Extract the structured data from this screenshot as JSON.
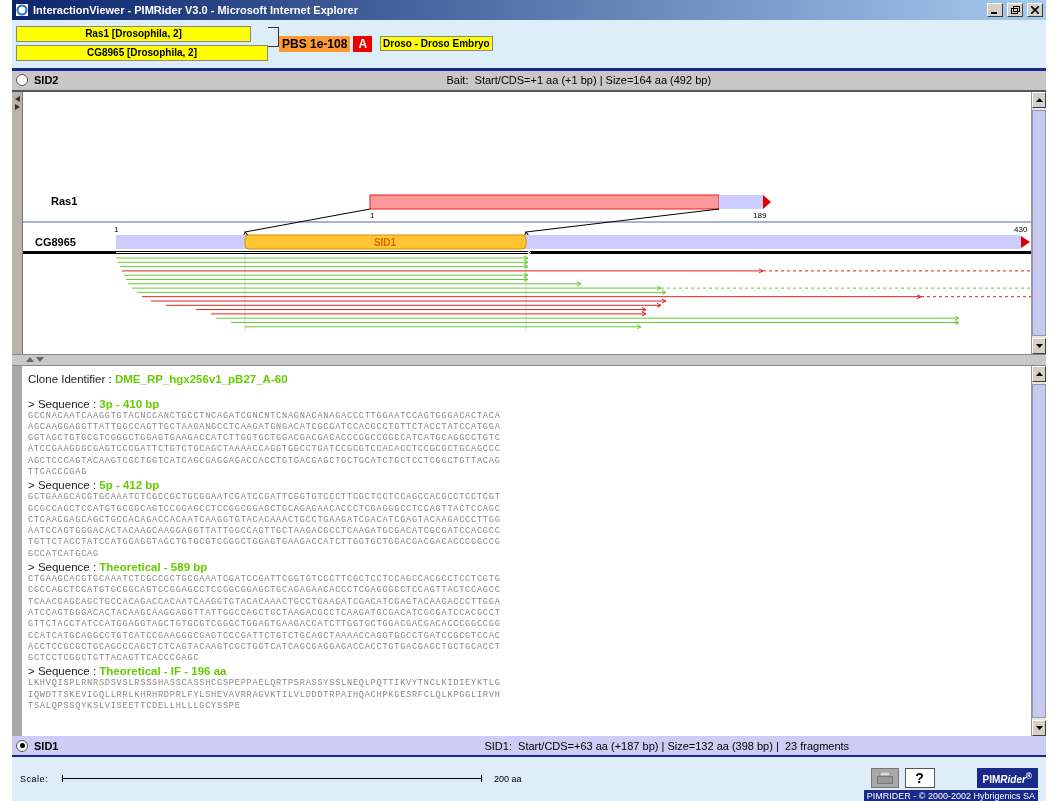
{
  "window": {
    "title": "InteractionViewer - PIMRider V3.0 - Microsoft Internet Explorer"
  },
  "header": {
    "proteins": [
      "Ras1 [Drosophila, 2]",
      "CG8965 [Drosophila, 2]"
    ],
    "score": "PBS 1e-108",
    "grade": "A",
    "library": "Droso - Droso Embryo"
  },
  "bait_bar": {
    "label": "SID2",
    "selected": false,
    "info": "Bait:  Start/CDS=+1 aa (+1 bp) | Size=164 aa (492 bp)"
  },
  "diagram": {
    "bait_name": "Ras1",
    "bait_start": "1",
    "bait_end": "189",
    "prey_name": "CG8965",
    "prey_start": "1",
    "prey_end": "430",
    "domain": "SID1"
  },
  "details": {
    "clone_label": "Clone Identifier : ",
    "clone_id": "DME_RP_hgx256v1_pB27_A-60",
    "sequences": [
      {
        "label": "> Sequence : ",
        "title": "3p - 410 bp",
        "lines": [
          "GCCNACAATCAAGGTGTACNCCANCTGCCTNCAGATCGNCNTCNAGNACANAGACCCTTGGAATCCAGTGGGACACTACA",
          "AGCAAGGAGGTTATTGGCCAGTTGCTAAGANGCCTCAAGATGNGACATCGCGATCCACGCCTGTTCTACCTATCCATGGA",
          "GGTAGCTGTGCGTCGGGCTGGAGTGAAGACCATCTTGGTGCTGGACGACGACACCCGGCCGGCCATCATGCAGGCCTGTC",
          "ATCCGAAGGGCGAGTCCCGATTCTGTCTGCAGCTAAAACCAGGTGGCCTGATCCGCGTCCACACCTCCGCGCTGCAGCCC",
          "AGCTCCCAGTACAAGTCGCTGGTCATCAGCGAGGAGACCACCTGTGACGAGCTGCTGCATCTGCTCCTCGGCTGTTACAG",
          "TTCACCCGAG"
        ]
      },
      {
        "label": "> Sequence : ",
        "title": "5p - 412 bp",
        "lines": [
          "GCTGAAGCACGTGCAAATCTCGCCGCTGCGGAATCGATCCGATTCGGTGTCCCTTCGCTCCTCCAGCCACGCCTCCTCGT",
          "GCGCCAGCTCCATGTGCGGCAGTCCGGAGCCTCCGGCGGAGCTGCAGAGAACACCCTCGAGGGCCTCCAGTTACTCCAGC",
          "CTCAACGAGCAGCTGCCACAGACCACAATCAAGGTGTACACAAACTGCCTGAAGATCGACATCGAGTACAAGACCCTTGG",
          "AATCCAGTGGGACACTACAAGCAAGGAGGTTATTGGCCAGTTGCTAAGACGCCTCAAGATGCGACATCGCGATCCACGCC",
          "TGTTCTACCTATCCATGGAGGTAGCTGTGCGTCGGGCTGGAGTGAAGACCATCTTGGTGCTGGACGACGACACCCGGCCG",
          "GCCATCATGCAG"
        ]
      },
      {
        "label": "> Sequence : ",
        "title": "Theoretical - 589 bp",
        "lines": [
          "CTGAAGCACGTGCAAATCTCGCCGCTGCGAAATCGATCCGATTCGGTGTCCCTTCGCTCCTCCAGCCACGCCTCCTCGTG",
          "CGCCAGCTCCATGTGCGGCAGTCCGGAGCCTCCGGCGGAGCTGCAGAGAACACCCTCGAGGGCCTCCAGTTACTCCAGCC",
          "TCAACGAGCAGCTGCCACAGACCACAATCAAGGTGTACACAAACTGCCTGAAGATCGACATCGAGTACAAGACCCTTGGA",
          "ATCCAGTGGGACACTACAAGCAAGGAGGTTATTGGCCAGCTGCTAAGACGCCTCAAGATGCGACATCGCGATCCACGCCT",
          "GTTCTACCTATCCATGGAGGTAGCTGTGCGTCGGGCTGGAGTGAAGACCATCTTGGTGCTGGACGACGACACCCGGCCGG",
          "CCATCATGCAGGCCTGTCATCCGAAGGGCGAGTCCCGATTCTGTCTGCAGCTAAAACCAGGTGGCCTGATCCGCGTCCAC",
          "ACCTCCGCGCTGCAGCCCAGCTCTCAGTACAAGTCGCTGGTCATCAGCGAGGAGACCACCTGTGACGAGCTGCTGCACCT",
          "GCTCCTCGGCTGTTACAGTTCACCCGAGC"
        ]
      },
      {
        "label": "> Sequence : ",
        "title": "Theoretical - IF - 196 aa",
        "lines": [
          "LKHVQISPLRNRSDSVSLRSSSHASSCASSHCGSPEPPAELQRTPSRASSYSSLNEQLPQTTIKVYTNCLKIDIEYKTLG",
          "IQWDTTSKEVIGQLLRRLKHRHRDPRLFYLSHEVAVRRAGVKTILVLDDDTRPAIHQACHPKGESRFCLQLKPGGLIRVH",
          "TSALQPSSQYKSLVISEETTCDELLHLLLGCYSSPE"
        ]
      }
    ]
  },
  "sid_bar": {
    "label": "SID1",
    "selected": true,
    "info": "SID1:  Start/CDS=+63 aa (+187 bp) | Size=132 aa (398 bp) |  23 fragments"
  },
  "footer": {
    "scale_label": "Scale:",
    "scale_value": "200 aa",
    "print_disabled": true,
    "help": "?",
    "logo": "PIM",
    "logo_italic": "Rider",
    "logo_mark": "®",
    "copyright": "PIMRIDER - © 2000-2002 Hybrigenics SA"
  }
}
